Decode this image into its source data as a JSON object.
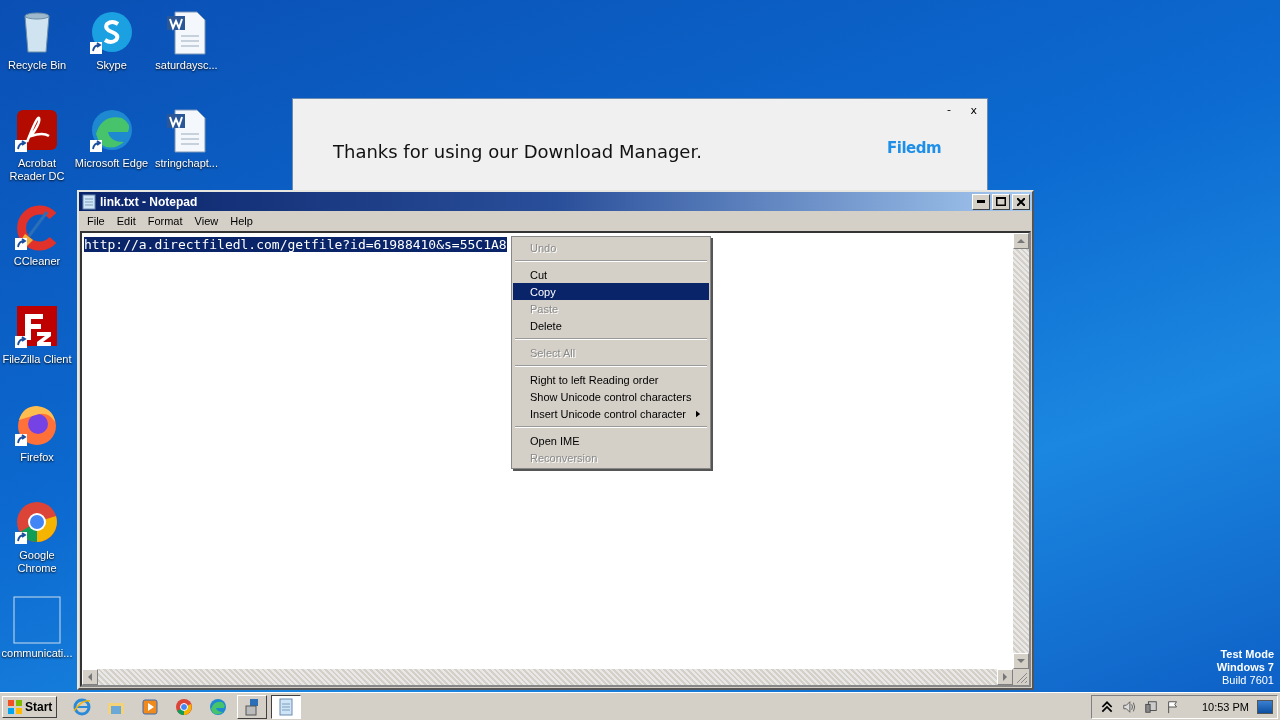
{
  "desktop_columns": [
    [
      {
        "label": "Recycle Bin",
        "kind": "recycle"
      },
      {
        "label": "Acrobat Reader DC",
        "kind": "acrobat"
      },
      {
        "label": "CCleaner",
        "kind": "ccleaner"
      },
      {
        "label": "FileZilla Client",
        "kind": "filezilla"
      },
      {
        "label": "Firefox",
        "kind": "firefox"
      },
      {
        "label": "Google Chrome",
        "kind": "chrome"
      },
      {
        "label": "communicati...",
        "kind": "blank"
      }
    ],
    [
      {
        "label": "Skype",
        "kind": "skype"
      },
      {
        "label": "Microsoft Edge",
        "kind": "edge"
      }
    ],
    [
      {
        "label": "saturdaysc...",
        "kind": "word"
      },
      {
        "label": "stringchapt...",
        "kind": "word"
      }
    ]
  ],
  "popup": {
    "message": "Thanks for using our Download Manager.",
    "brand": "Filedm",
    "minimize": "-",
    "close": "x"
  },
  "notepad": {
    "title": "link.txt - Notepad",
    "menu": [
      "File",
      "Edit",
      "Format",
      "View",
      "Help"
    ],
    "text": "http://a.directfiledl.com/getfile?id=61988410&s=55C1A8",
    "text_selected": true
  },
  "context_menu": [
    {
      "kind": "item",
      "label": "Undo",
      "disabled": true,
      "selected": false,
      "submenu": false
    },
    {
      "kind": "separator"
    },
    {
      "kind": "item",
      "label": "Cut",
      "disabled": false,
      "selected": false,
      "submenu": false
    },
    {
      "kind": "item",
      "label": "Copy",
      "disabled": false,
      "selected": true,
      "submenu": false
    },
    {
      "kind": "item",
      "label": "Paste",
      "disabled": true,
      "selected": false,
      "submenu": false
    },
    {
      "kind": "item",
      "label": "Delete",
      "disabled": false,
      "selected": false,
      "submenu": false
    },
    {
      "kind": "separator"
    },
    {
      "kind": "item",
      "label": "Select All",
      "disabled": true,
      "selected": false,
      "submenu": false
    },
    {
      "kind": "separator"
    },
    {
      "kind": "item",
      "label": "Right to left Reading order",
      "disabled": false,
      "selected": false,
      "submenu": false
    },
    {
      "kind": "item",
      "label": "Show Unicode control characters",
      "disabled": false,
      "selected": false,
      "submenu": false
    },
    {
      "kind": "item",
      "label": "Insert Unicode control character",
      "disabled": false,
      "selected": false,
      "submenu": true
    },
    {
      "kind": "separator"
    },
    {
      "kind": "item",
      "label": "Open IME",
      "disabled": false,
      "selected": false,
      "submenu": false
    },
    {
      "kind": "item",
      "label": "Reconversion",
      "disabled": true,
      "selected": false,
      "submenu": false
    }
  ],
  "taskbar": {
    "start": "Start",
    "apps": [
      {
        "kind": "ie",
        "active": false
      },
      {
        "kind": "explorer",
        "active": false
      },
      {
        "kind": "media",
        "active": false
      },
      {
        "kind": "chrome",
        "active": false
      },
      {
        "kind": "edge",
        "active": false
      },
      {
        "kind": "setup",
        "active": false
      },
      {
        "kind": "notepad",
        "active": true
      }
    ],
    "clock": "10:53 PM"
  },
  "test_mode": [
    "Test Mode",
    "Windows 7",
    "Build 7601"
  ]
}
